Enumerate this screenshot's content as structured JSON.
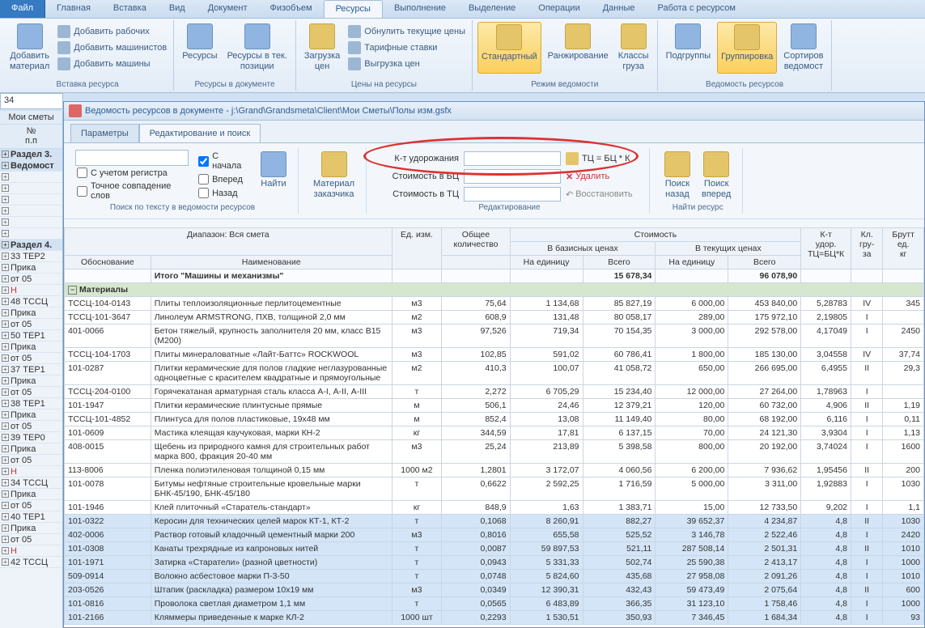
{
  "menu": {
    "file": "Файл",
    "tabs": [
      "Главная",
      "Вставка",
      "Вид",
      "Документ",
      "Физобъем",
      "Ресурсы",
      "Выполнение",
      "Выделение",
      "Операции",
      "Данные",
      "Работа с ресурсом"
    ],
    "active": 5
  },
  "ribbon": {
    "add_material": "Добавить\nматериал",
    "add_workers": "Добавить рабочих",
    "add_machinists": "Добавить машинистов",
    "add_machines": "Добавить машины",
    "resources": "Ресурсы",
    "resources_pos": "Ресурсы в тек.\nпозиции",
    "load_prices": "Загрузка\nцен",
    "zero_prices": "Обнулить текущие цены",
    "tariff": "Тарифные ставки",
    "export_prices": "Выгрузка цен",
    "standard": "Стандартный",
    "ranking": "Ранжирование",
    "classes": "Классы\nгруза",
    "subgroups": "Подгруппы",
    "grouping": "Группировка",
    "sorting": "Сортиров\nведомост",
    "group1": "Вставка ресурса",
    "group2": "Ресурсы в документе",
    "group3": "Цены на ресурсы",
    "group4": "Режим ведомости",
    "group5": "Ведомость ресурсов"
  },
  "formula_cell": "34",
  "left": {
    "tab": "Мои сметы",
    "hdr1": "№\nп.п",
    "rows": [
      {
        "t": "Раздел 3.",
        "s": true
      },
      {
        "t": "Ведомост",
        "s": true
      },
      {
        "t": ""
      },
      {
        "t": ""
      },
      {
        "t": ""
      },
      {
        "t": ""
      },
      {
        "t": ""
      },
      {
        "t": ""
      },
      {
        "t": "Раздел 4.",
        "s": true
      },
      {
        "t": "33 ТЕР2"
      },
      {
        "t": "Прика"
      },
      {
        "t": "от 05"
      },
      {
        "t": "Н",
        "r": true
      },
      {
        "t": "48 ТССЦ"
      },
      {
        "t": "Прика"
      },
      {
        "t": "от 05"
      },
      {
        "t": "50 ТЕР1"
      },
      {
        "t": "Прика"
      },
      {
        "t": "от 05"
      },
      {
        "t": "37 ТЕР1"
      },
      {
        "t": "Прика"
      },
      {
        "t": "от 05"
      },
      {
        "t": "38 ТЕР1"
      },
      {
        "t": "Прика"
      },
      {
        "t": "от 05"
      },
      {
        "t": "39 ТЕР0"
      },
      {
        "t": "Прика"
      },
      {
        "t": "от 05"
      },
      {
        "t": "Н",
        "r": true
      },
      {
        "t": "34 ТССЦ"
      },
      {
        "t": "Прика"
      },
      {
        "t": "от 05"
      },
      {
        "t": "40 ТЕР1"
      },
      {
        "t": "Прика"
      },
      {
        "t": "от 05"
      },
      {
        "t": "Н",
        "r": true
      },
      {
        "t": "42 ТССЦ"
      }
    ]
  },
  "doc_title": "Ведомость ресурсов в документе - j:\\Grand\\Grandsmeta\\Client\\Мои Сметы\\Полы изм.gsfx",
  "wtabs": {
    "params": "Параметры",
    "edit": "Редактирование и поиск"
  },
  "search": {
    "from_start": "С начала",
    "with_case": "С учетом регистра",
    "exact": "Точное совпадение слов",
    "forward": "Вперед",
    "back": "Назад",
    "find": "Найти",
    "glabel": "Поиск по тексту в ведомости ресурсов"
  },
  "mat_customer": "Материал\nзаказчика",
  "edit": {
    "k_label": "К-т удорожания",
    "cost_bc": "Стоимость в БЦ",
    "cost_tc": "Стоимость в ТЦ",
    "formula": "ТЦ = БЦ * К",
    "delete": "Удалить",
    "restore": "Восстановить",
    "glabel": "Редактирование"
  },
  "find_res": {
    "back": "Поиск\nназад",
    "fwd": "Поиск\nвперед",
    "glabel": "Найти ресурс"
  },
  "grid": {
    "hdr": {
      "range": "Диапазон: Вся смета",
      "qty": "Общее\nколичество",
      "cost": "Стоимость",
      "k": "К-т\nудор.\nТЦ=БЦ*К",
      "cls": "Кл.\nгру-\nза",
      "brutto": "Брутт\nед.\nкг",
      "base": "В базисных ценах",
      "cur": "В текущих ценах",
      "code": "Обоснование",
      "name": "Наименование",
      "unit": "Ед. изм.",
      "per_unit": "На единицу",
      "total": "Всего"
    },
    "total_row": {
      "name": "Итого \"Машины и механизмы\"",
      "base_total": "15 678,34",
      "cur_total": "96 078,90"
    },
    "cat": "Материалы",
    "rows": [
      {
        "c": "ТССЦ-104-0143",
        "n": "Плиты теплоизоляционные перлитоцементные",
        "u": "м3",
        "q": "75,64",
        "bpu": "1 134,68",
        "bt": "85 827,19",
        "cpu": "6 000,00",
        "ct": "453 840,00",
        "k": "5,28783",
        "cl": "IV",
        "br": "345"
      },
      {
        "c": "ТССЦ-101-3647",
        "n": "Линолеум ARMSTRONG, ПХВ, толщиной 2,0 мм",
        "u": "м2",
        "q": "608,9",
        "bpu": "131,48",
        "bt": "80 058,17",
        "cpu": "289,00",
        "ct": "175 972,10",
        "k": "2,19805",
        "cl": "I",
        "br": ""
      },
      {
        "c": "401-0066",
        "n": "Бетон тяжелый, крупность заполнителя 20 мм, класс В15 (М200)",
        "u": "м3",
        "q": "97,526",
        "bpu": "719,34",
        "bt": "70 154,35",
        "cpu": "3 000,00",
        "ct": "292 578,00",
        "k": "4,17049",
        "cl": "I",
        "br": "2450"
      },
      {
        "c": "ТССЦ-104-1703",
        "n": "Плиты минераловатные «Лайт-Баттс» ROCKWOOL",
        "u": "м3",
        "q": "102,85",
        "bpu": "591,02",
        "bt": "60 786,41",
        "cpu": "1 800,00",
        "ct": "185 130,00",
        "k": "3,04558",
        "cl": "IV",
        "br": "37,74"
      },
      {
        "c": "101-0287",
        "n": "Плитки керамические для полов гладкие неглазурованные одноцветные с красителем квадратные и прямоугольные",
        "u": "м2",
        "q": "410,3",
        "bpu": "100,07",
        "bt": "41 058,72",
        "cpu": "650,00",
        "ct": "266 695,00",
        "k": "6,4955",
        "cl": "II",
        "br": "29,3"
      },
      {
        "c": "ТССЦ-204-0100",
        "n": "Горячекатаная арматурная сталь класса А-I, А-II, А-III",
        "u": "т",
        "q": "2,272",
        "bpu": "6 705,29",
        "bt": "15 234,40",
        "cpu": "12 000,00",
        "ct": "27 264,00",
        "k": "1,78963",
        "cl": "I",
        "br": ""
      },
      {
        "c": "101-1947",
        "n": "Плитки керамические плинтусные прямые",
        "u": "м",
        "q": "506,1",
        "bpu": "24,46",
        "bt": "12 379,21",
        "cpu": "120,00",
        "ct": "60 732,00",
        "k": "4,906",
        "cl": "II",
        "br": "1,19"
      },
      {
        "c": "ТССЦ-101-4852",
        "n": "Плинтуса для полов пластиковые, 19х48 мм",
        "u": "м",
        "q": "852,4",
        "bpu": "13,08",
        "bt": "11 149,40",
        "cpu": "80,00",
        "ct": "68 192,00",
        "k": "6,116",
        "cl": "I",
        "br": "0,11"
      },
      {
        "c": "101-0609",
        "n": "Мастика клеящая каучуковая, марки КН-2",
        "u": "кг",
        "q": "344,59",
        "bpu": "17,81",
        "bt": "6 137,15",
        "cpu": "70,00",
        "ct": "24 121,30",
        "k": "3,9304",
        "cl": "I",
        "br": "1,13"
      },
      {
        "c": "408-0015",
        "n": "Щебень из природного камня для строительных работ марка 800, фракция 20-40 мм",
        "u": "м3",
        "q": "25,24",
        "bpu": "213,89",
        "bt": "5 398,58",
        "cpu": "800,00",
        "ct": "20 192,00",
        "k": "3,74024",
        "cl": "I",
        "br": "1600"
      },
      {
        "c": "113-8006",
        "n": "Пленка полиэтиленовая толщиной 0,15 мм",
        "u": "1000 м2",
        "q": "1,2801",
        "bpu": "3 172,07",
        "bt": "4 060,56",
        "cpu": "6 200,00",
        "ct": "7 936,62",
        "k": "1,95456",
        "cl": "II",
        "br": "200"
      },
      {
        "c": "101-0078",
        "n": "Битумы нефтяные строительные кровельные марки БНК-45/190, БНК-45/180",
        "u": "т",
        "q": "0,6622",
        "bpu": "2 592,25",
        "bt": "1 716,59",
        "cpu": "5 000,00",
        "ct": "3 311,00",
        "k": "1,92883",
        "cl": "I",
        "br": "1030"
      },
      {
        "c": "101-1946",
        "n": "Клей плиточный «Старатель-стандарт»",
        "u": "кг",
        "q": "848,9",
        "bpu": "1,63",
        "bt": "1 383,71",
        "cpu": "15,00",
        "ct": "12 733,50",
        "k": "9,202",
        "cl": "I",
        "br": "1,1"
      },
      {
        "c": "101-0322",
        "n": "Керосин для технических целей марок КТ-1, КТ-2",
        "u": "т",
        "q": "0,1068",
        "bpu": "8 260,91",
        "bt": "882,27",
        "cpu": "39 652,37",
        "ct": "4 234,87",
        "k": "4,8",
        "cl": "II",
        "br": "1030",
        "sel": true
      },
      {
        "c": "402-0006",
        "n": "Раствор готовый кладочный цементный марки 200",
        "u": "м3",
        "q": "0,8016",
        "bpu": "655,58",
        "bt": "525,52",
        "cpu": "3 146,78",
        "ct": "2 522,46",
        "k": "4,8",
        "cl": "I",
        "br": "2420",
        "sel": true
      },
      {
        "c": "101-0308",
        "n": "Канаты трехрядные из капроновых нитей",
        "u": "т",
        "q": "0,0087",
        "bpu": "59 897,53",
        "bt": "521,11",
        "cpu": "287 508,14",
        "ct": "2 501,31",
        "k": "4,8",
        "cl": "II",
        "br": "1010",
        "sel": true
      },
      {
        "c": "101-1971",
        "n": "Затирка «Старатели» (разной цветности)",
        "u": "т",
        "q": "0,0943",
        "bpu": "5 331,33",
        "bt": "502,74",
        "cpu": "25 590,38",
        "ct": "2 413,17",
        "k": "4,8",
        "cl": "I",
        "br": "1000",
        "sel": true
      },
      {
        "c": "509-0914",
        "n": "Волокно асбестовое марки П-3-50",
        "u": "т",
        "q": "0,0748",
        "bpu": "5 824,60",
        "bt": "435,68",
        "cpu": "27 958,08",
        "ct": "2 091,26",
        "k": "4,8",
        "cl": "I",
        "br": "1010",
        "sel": true
      },
      {
        "c": "203-0526",
        "n": "Штапик (раскладка) размером 10х19 мм",
        "u": "м3",
        "q": "0,0349",
        "bpu": "12 390,31",
        "bt": "432,43",
        "cpu": "59 473,49",
        "ct": "2 075,64",
        "k": "4,8",
        "cl": "II",
        "br": "600",
        "sel": true
      },
      {
        "c": "101-0816",
        "n": "Проволока светлая диаметром 1,1 мм",
        "u": "т",
        "q": "0,0565",
        "bpu": "6 483,89",
        "bt": "366,35",
        "cpu": "31 123,10",
        "ct": "1 758,46",
        "k": "4,8",
        "cl": "I",
        "br": "1000",
        "sel": true
      },
      {
        "c": "101-2166",
        "n": "Кляммеры приведенные к марке КЛ-2",
        "u": "1000 шт",
        "q": "0,2293",
        "bpu": "1 530,51",
        "bt": "350,93",
        "cpu": "7 346,45",
        "ct": "1 684,34",
        "k": "4,8",
        "cl": "I",
        "br": "93",
        "sel": true
      }
    ]
  }
}
